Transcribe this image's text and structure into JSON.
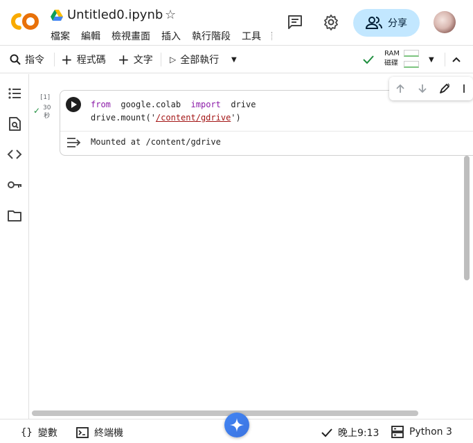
{
  "header": {
    "logo_text": "CO",
    "title": "Untitled0.ipynb",
    "menu": [
      "檔案",
      "編輯",
      "檢視畫面",
      "插入",
      "執行階段",
      "工具"
    ],
    "share_label": "分享"
  },
  "toolbar": {
    "commands_label": "指令",
    "code_label": "程式碼",
    "text_label": "文字",
    "run_all_label": "全部執行",
    "ram_label": "RAM",
    "disk_label": "磁碟"
  },
  "cell": {
    "exec_count": "[1]",
    "exec_time_value": "30",
    "exec_time_unit": "秒",
    "code_line1": {
      "kw1": "from",
      "mod": "google.colab",
      "kw2": "import",
      "name": "drive"
    },
    "code_line2": {
      "pre": "drive.mount('",
      "str": "/content/gdrive",
      "post": "')"
    },
    "output": "Mounted at /content/gdrive"
  },
  "statusbar": {
    "variables_label": "變數",
    "terminal_label": "終端機",
    "time": "晚上9:13",
    "runtime": "Python 3"
  },
  "colors": {
    "accent": "#c2e7ff",
    "keyword": "#8b1aa8",
    "string": "#a31515",
    "success": "#1e8e3e",
    "logo_orange": "#f9ab00",
    "logo_dark_orange": "#e8710a"
  },
  "icons": [
    "comment-icon",
    "gear-icon",
    "people-icon",
    "search-icon",
    "plus-icon",
    "play-icon",
    "chevron-down-icon",
    "chevron-up-icon",
    "check-icon",
    "list-icon",
    "find-icon",
    "code-icon",
    "key-icon",
    "folder-icon",
    "arrow-up-icon",
    "arrow-down-icon",
    "edit-icon",
    "output-icon",
    "braces-icon",
    "terminal-icon",
    "server-icon",
    "sparkle-icon"
  ]
}
